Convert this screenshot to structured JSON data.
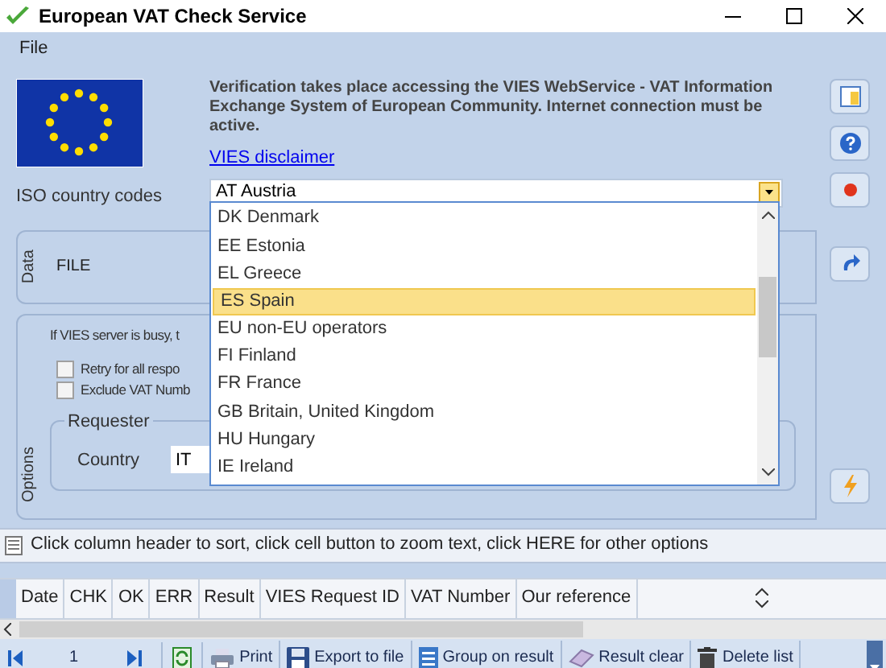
{
  "window": {
    "title": "European VAT Check Service"
  },
  "menu": [
    "File"
  ],
  "info": {
    "text": "Verification takes place accessing the VIES WebService - VAT Information Exchange System of European Community. Internet connection must be active.",
    "link": "VIES disclaimer"
  },
  "country_codes": {
    "label": "ISO country codes",
    "value": "AT Austria",
    "expanded": true,
    "options": [
      {
        "label": "DK Denmark",
        "selected": false
      },
      {
        "label": "EE Estonia",
        "selected": false
      },
      {
        "label": "EL Greece",
        "selected": false
      },
      {
        "label": "ES Spain",
        "selected": true
      },
      {
        "label": "EU non-EU operators",
        "selected": false
      },
      {
        "label": "FI Finland",
        "selected": false
      },
      {
        "label": "FR France",
        "selected": false
      },
      {
        "label": "GB Britain, United Kingdom",
        "selected": false
      },
      {
        "label": "HU Hungary",
        "selected": false
      },
      {
        "label": "IE Ireland",
        "selected": false
      }
    ]
  },
  "data_group": {
    "title": "Data",
    "label": "FILE"
  },
  "options_group": {
    "title": "Options",
    "note": "If VIES server is busy, t",
    "checkboxes": [
      {
        "label": "Retry for all respo",
        "checked": false
      },
      {
        "label": "Exclude VAT Numb",
        "checked": false
      }
    ],
    "requester": {
      "title": "Requester",
      "country_label": "Country",
      "country_value": "IT"
    }
  },
  "hint_bar": "Click column header to sort, click cell button to zoom text, click HERE for other options",
  "table": {
    "columns": [
      "Date",
      "CHK",
      "OK",
      "ERR",
      "Result",
      "VIES Request ID",
      "VAT Number",
      "Our reference"
    ]
  },
  "toolbar": {
    "page": "1",
    "buttons": [
      {
        "label": "Print",
        "kind": "print"
      },
      {
        "label": "Export to file",
        "kind": "export"
      },
      {
        "label": "Group on result",
        "kind": "group"
      },
      {
        "label": "Result clear",
        "kind": "clear"
      },
      {
        "label": "Delete list",
        "kind": "delete"
      }
    ]
  }
}
